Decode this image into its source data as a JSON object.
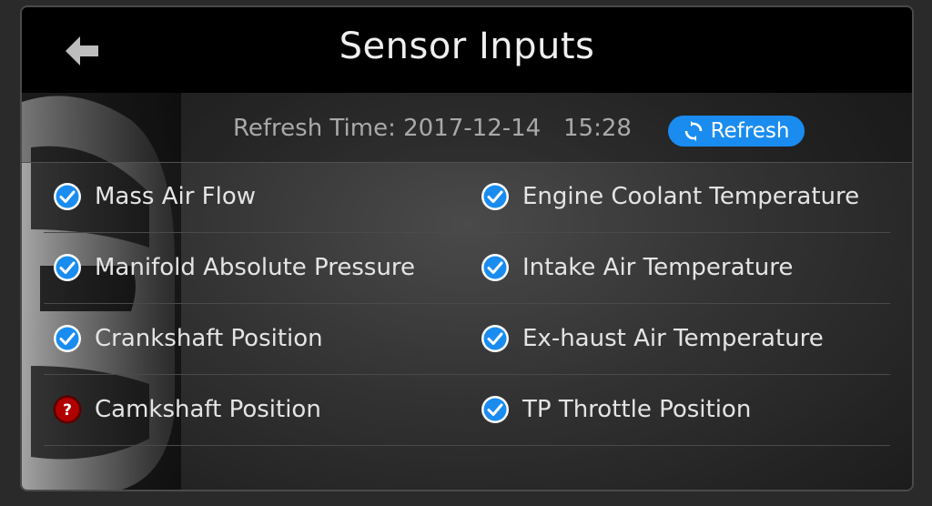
{
  "header": {
    "title": "Sensor Inputs",
    "back_icon": "back-arrow-icon"
  },
  "refresh": {
    "label": "Refresh Time: 2017-12-14   15:28",
    "button_label": "Refresh",
    "button_icon": "refresh-icon",
    "accent_color": "#1a8cf0"
  },
  "sensors": {
    "rows": [
      {
        "left": {
          "label": "Mass Air Flow",
          "status": "ok"
        },
        "right": {
          "label": "Engine Coolant Temperature",
          "status": "ok"
        }
      },
      {
        "left": {
          "label": "Manifold Absolute Pressure",
          "status": "ok"
        },
        "right": {
          "label": "Intake Air Temperature",
          "status": "ok"
        }
      },
      {
        "left": {
          "label": "Crankshaft Position",
          "status": "ok"
        },
        "right": {
          "label": "Ex-haust Air Temperature",
          "status": "ok"
        }
      },
      {
        "left": {
          "label": "Camkshaft Position",
          "status": "unknown"
        },
        "right": {
          "label": "TP Throttle Position",
          "status": "ok"
        }
      }
    ]
  },
  "status_colors": {
    "ok": "#1a8cf0",
    "unknown": "#b00000"
  }
}
